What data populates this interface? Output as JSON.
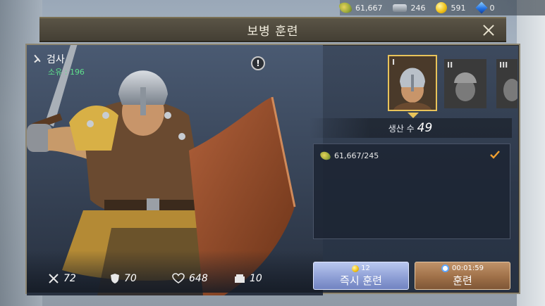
{
  "resources": [
    {
      "icon": "wheat-icon",
      "value": "61,667"
    },
    {
      "icon": "iron-icon",
      "value": "246"
    },
    {
      "icon": "gold-icon",
      "value": "591"
    },
    {
      "icon": "gem-icon",
      "value": "0"
    }
  ],
  "title": "보병 훈련",
  "unit": {
    "name": "검사",
    "owned": "소유 : 196"
  },
  "stats": [
    {
      "icon": "attack-icon",
      "value": "72"
    },
    {
      "icon": "defense-icon",
      "value": "70"
    },
    {
      "icon": "health-icon",
      "value": "648"
    },
    {
      "icon": "load-icon",
      "value": "10"
    }
  ],
  "tiers": [
    {
      "label": "I",
      "active": true
    },
    {
      "label": "II",
      "active": false
    },
    {
      "label": "III",
      "active": false
    }
  ],
  "production": {
    "label": "생산 수",
    "value": "49"
  },
  "requirement": {
    "icon": "wheat-icon",
    "text": "61,667/245",
    "met": true
  },
  "buttons": {
    "instant": {
      "cost": "12",
      "label": "즉시 훈련"
    },
    "train": {
      "time": "00:01:59",
      "label": "훈련"
    }
  },
  "colors": {
    "accent": "#e8c35a",
    "owned": "#5fe08c",
    "check": "#f0a030"
  }
}
